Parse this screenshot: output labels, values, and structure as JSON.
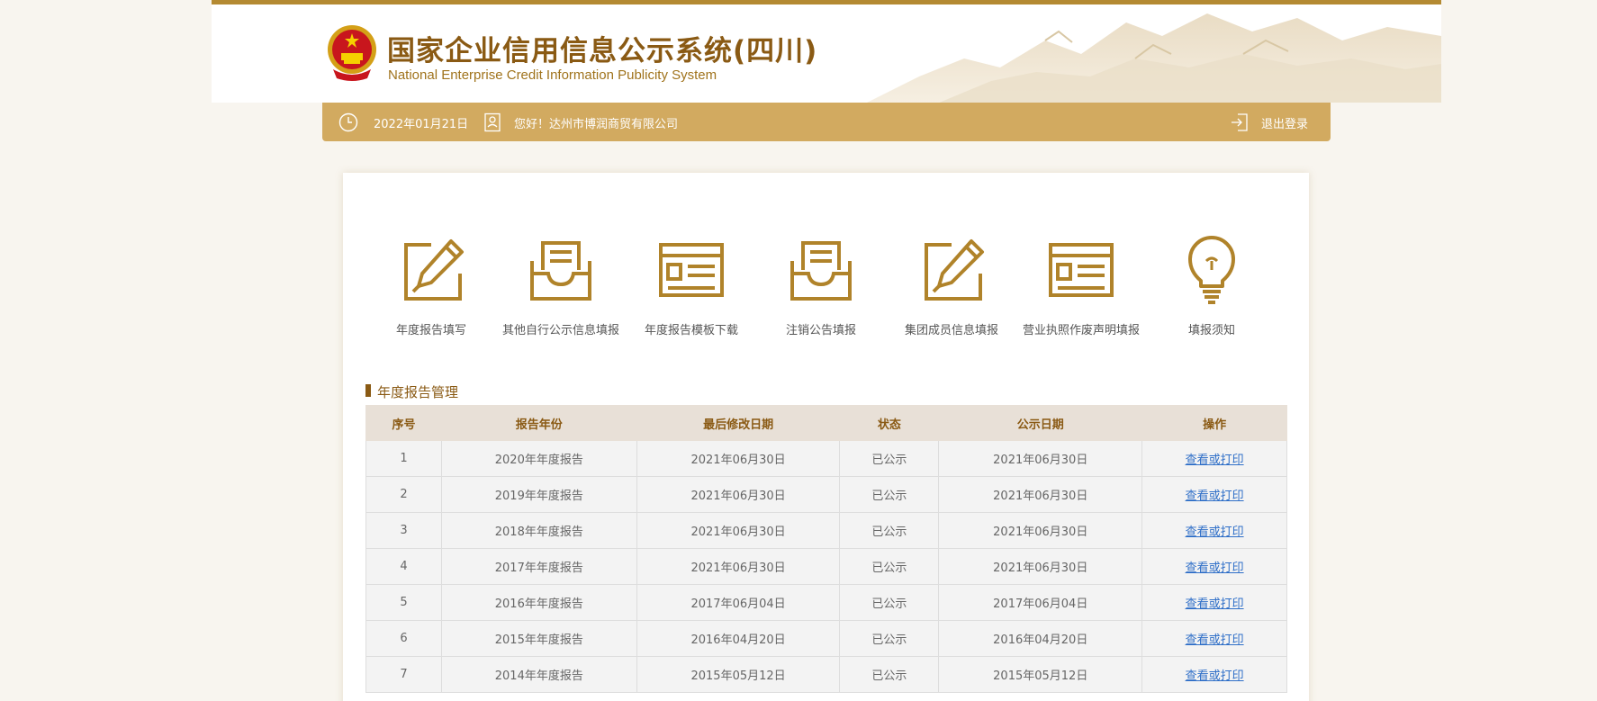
{
  "header": {
    "title_cn": "国家企业信用信息公示系统(四川)",
    "title_en": "National Enterprise Credit Information Publicity System"
  },
  "userbar": {
    "date": "2022年01月21日",
    "greeting": "您好！达州市博润商贸有限公司",
    "logout_label": "退出登录"
  },
  "functions": [
    {
      "label": "年度报告填写",
      "icon": "edit-pencil-icon"
    },
    {
      "label": "其他自行公示信息填报",
      "icon": "inbox-tray-icon"
    },
    {
      "label": "年度报告模板下载",
      "icon": "template-form-icon"
    },
    {
      "label": "注销公告填报",
      "icon": "inbox-tray-icon"
    },
    {
      "label": "集团成员信息填报",
      "icon": "edit-pencil-icon"
    },
    {
      "label": "营业执照作废声明填报",
      "icon": "template-form-icon"
    },
    {
      "label": "填报须知",
      "icon": "lightbulb-icon"
    }
  ],
  "section": {
    "title": "年度报告管理"
  },
  "table": {
    "headers": [
      "序号",
      "报告年份",
      "最后修改日期",
      "状态",
      "公示日期",
      "操作"
    ],
    "rows": [
      [
        "1",
        "2020年年度报告",
        "2021年06月30日",
        "已公示",
        "2021年06月30日",
        "查看或打印"
      ],
      [
        "2",
        "2019年年度报告",
        "2021年06月30日",
        "已公示",
        "2021年06月30日",
        "查看或打印"
      ],
      [
        "3",
        "2018年年度报告",
        "2021年06月30日",
        "已公示",
        "2021年06月30日",
        "查看或打印"
      ],
      [
        "4",
        "2017年年度报告",
        "2021年06月30日",
        "已公示",
        "2021年06月30日",
        "查看或打印"
      ],
      [
        "5",
        "2016年年度报告",
        "2017年06月04日",
        "已公示",
        "2017年06月04日",
        "查看或打印"
      ],
      [
        "6",
        "2015年年度报告",
        "2016年04月20日",
        "已公示",
        "2016年04月20日",
        "查看或打印"
      ],
      [
        "7",
        "2014年年度报告",
        "2015年05月12日",
        "已公示",
        "2015年05月12日",
        "查看或打印"
      ]
    ]
  },
  "colors": {
    "brand_gold": "#d2aa60",
    "dark_gold": "#8a5a14",
    "link_blue": "#2f6fc8"
  }
}
